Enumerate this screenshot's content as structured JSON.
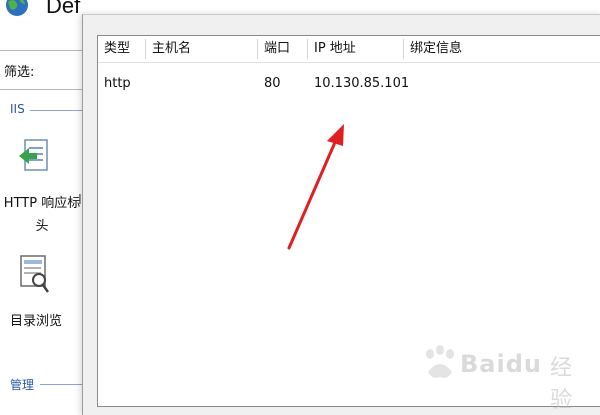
{
  "background_window": {
    "title": "Def",
    "filter_label": "筛选:",
    "section_iis": "IIS",
    "section_manage": "管理",
    "features": [
      {
        "label_line1": "HTTP 响应标",
        "label_line2": "头",
        "icon": "http-response-headers-icon"
      },
      {
        "label_line1": "目录浏览",
        "icon": "directory-browsing-icon"
      }
    ],
    "stray_char": "I"
  },
  "dialog": {
    "bindings_table": {
      "columns": [
        "类型",
        "主机名",
        "端口",
        "IP 地址",
        "绑定信息"
      ],
      "rows": [
        {
          "type": "http",
          "host": "",
          "port": "80",
          "ip": "10.130.85.101",
          "binding_info": ""
        }
      ]
    }
  },
  "annotation": {
    "arrow_color": "#e02020"
  },
  "watermark": {
    "text": "Baidu",
    "sub": "经验"
  }
}
